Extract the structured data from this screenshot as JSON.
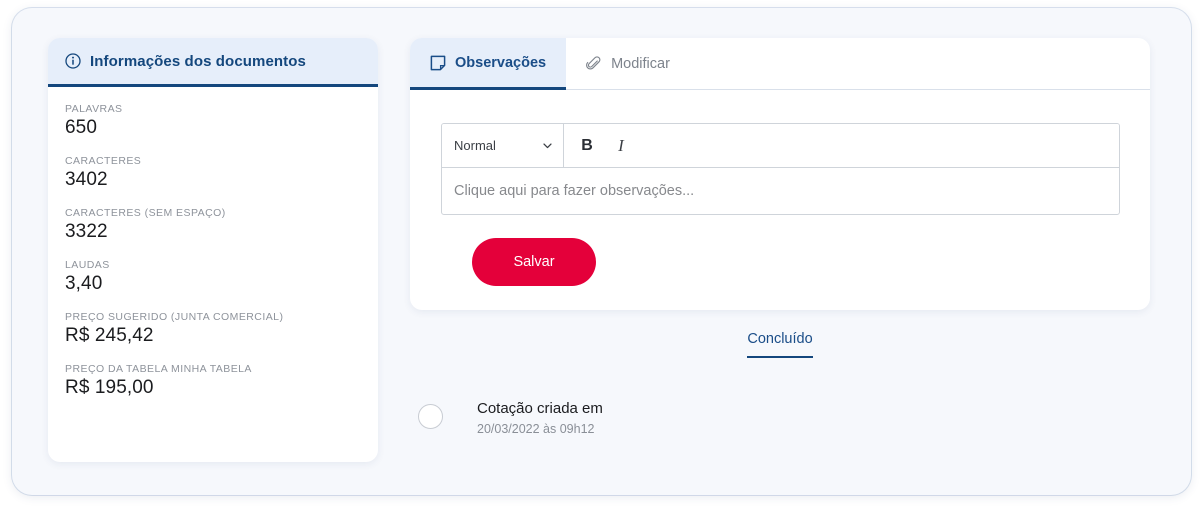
{
  "left_panel": {
    "icon": "info-circle-icon",
    "title": "Informações dos documentos",
    "stats": [
      {
        "label": "PALAVRAS",
        "value": "650"
      },
      {
        "label": "CARACTERES",
        "value": "3402"
      },
      {
        "label": "CARACTERES (SEM ESPAÇO)",
        "value": "3322"
      },
      {
        "label": "LAUDAS",
        "value": "3,40"
      },
      {
        "label": "PREÇO SUGERIDO (JUNTA COMERCIAL)",
        "value": "R$ 245,42"
      },
      {
        "label": "PREÇO DA TABELA MINHA TABELA",
        "value": "R$ 195,00"
      }
    ]
  },
  "right_panel": {
    "tabs": [
      {
        "label": "Observações",
        "icon": "note-icon",
        "active": true
      },
      {
        "label": "Modificar",
        "icon": "paperclip-icon",
        "active": false
      }
    ],
    "editor": {
      "format_select": {
        "value": "Normal",
        "icon": "chevron-down-icon"
      },
      "bold_label": "B",
      "italic_label": "I",
      "placeholder": "Clique aqui para fazer observações...",
      "content": ""
    },
    "save_label": "Salvar"
  },
  "status": {
    "label": "Concluído"
  },
  "timeline": [
    {
      "title": "Cotação criada em",
      "date": "20/03/2022 às 09h12"
    }
  ],
  "colors": {
    "navy": "#14477d",
    "header_tint": "#e6eefa",
    "accent_red": "#e4003a",
    "page_bg": "#f6f8fc"
  }
}
